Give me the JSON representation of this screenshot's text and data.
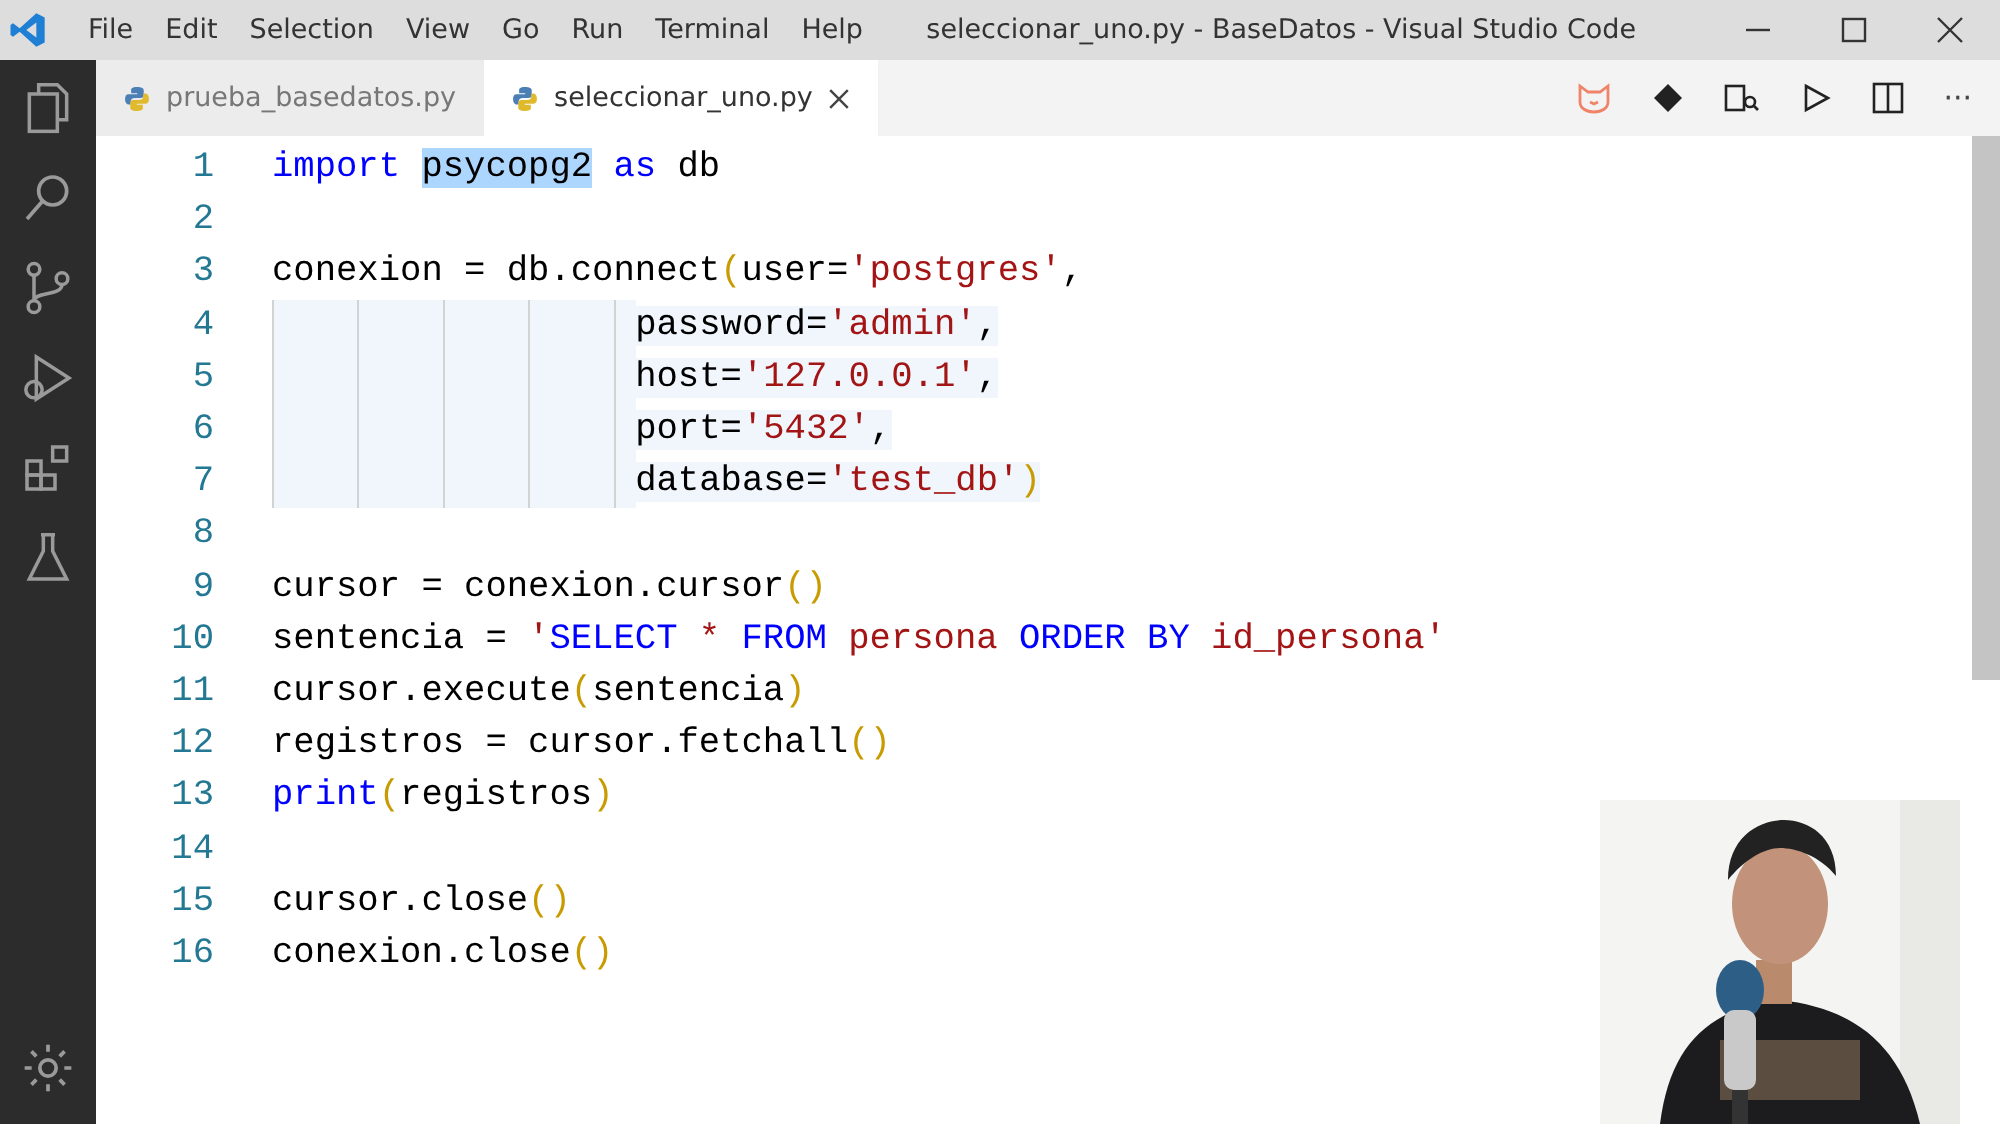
{
  "menu": [
    "File",
    "Edit",
    "Selection",
    "View",
    "Go",
    "Run",
    "Terminal",
    "Help"
  ],
  "window": {
    "title": "seleccionar_uno.py - BaseDatos - Visual Studio Code"
  },
  "tabs": [
    {
      "label": "prueba_basedatos.py",
      "selected": false
    },
    {
      "label": "seleccionar_uno.py",
      "selected": true
    }
  ],
  "editor_actions": {
    "more": "···"
  },
  "lines": [
    {
      "number": "1",
      "shaded": false,
      "continuation": false,
      "tokens": [
        {
          "kind": "kw",
          "text": "import "
        },
        {
          "kind": "sel",
          "text": "psycopg2"
        },
        {
          "kind": "kw",
          "text": " as"
        },
        {
          "kind": "plain",
          "text": " db"
        }
      ]
    },
    {
      "number": "2",
      "shaded": false,
      "continuation": false
    },
    {
      "number": "3",
      "shaded": false,
      "continuation": false,
      "tokens": [
        {
          "kind": "plain",
          "text": "conexion = db.connect"
        },
        {
          "kind": "bracket",
          "text": "("
        },
        {
          "kind": "plain",
          "text": "user="
        },
        {
          "kind": "str",
          "text": "'postgres'"
        },
        {
          "kind": "plain",
          "text": ","
        }
      ]
    },
    {
      "number": "4",
      "shaded": true,
      "continuation": true,
      "tokens": [
        {
          "kind": "plain",
          "text": "password="
        },
        {
          "kind": "str",
          "text": "'admin'"
        },
        {
          "kind": "plain",
          "text": ","
        }
      ]
    },
    {
      "number": "5",
      "shaded": true,
      "continuation": true,
      "tokens": [
        {
          "kind": "plain",
          "text": "host="
        },
        {
          "kind": "str",
          "text": "'127.0.0.1'"
        },
        {
          "kind": "plain",
          "text": ","
        }
      ]
    },
    {
      "number": "6",
      "shaded": true,
      "continuation": true,
      "tokens": [
        {
          "kind": "plain",
          "text": "port="
        },
        {
          "kind": "str",
          "text": "'5432'"
        },
        {
          "kind": "plain",
          "text": ","
        }
      ]
    },
    {
      "number": "7",
      "shaded": true,
      "continuation": true,
      "tokens": [
        {
          "kind": "plain",
          "text": "database="
        },
        {
          "kind": "str",
          "text": "'test_db'"
        },
        {
          "kind": "bracket",
          "text": ")"
        }
      ]
    },
    {
      "number": "8",
      "shaded": false,
      "continuation": false
    },
    {
      "number": "9",
      "shaded": false,
      "continuation": false,
      "tokens": [
        {
          "kind": "plain",
          "text": "cursor = conexion.cursor"
        },
        {
          "kind": "bracket",
          "text": "()"
        }
      ]
    },
    {
      "number": "10",
      "shaded": false,
      "continuation": false,
      "tokens": [
        {
          "kind": "plain",
          "text": "sentencia = "
        },
        {
          "kind": "str",
          "text": "'"
        },
        {
          "kind": "sqlkw",
          "text": "SELECT"
        },
        {
          "kind": "str",
          "text": " * "
        },
        {
          "kind": "sqlkw",
          "text": "FROM"
        },
        {
          "kind": "str",
          "text": " persona "
        },
        {
          "kind": "sqlkw",
          "text": "ORDER BY"
        },
        {
          "kind": "str",
          "text": " id_persona'"
        }
      ]
    },
    {
      "number": "11",
      "shaded": false,
      "continuation": false,
      "tokens": [
        {
          "kind": "plain",
          "text": "cursor.execute"
        },
        {
          "kind": "bracket",
          "text": "("
        },
        {
          "kind": "plain",
          "text": "sentencia"
        },
        {
          "kind": "bracket",
          "text": ")"
        }
      ]
    },
    {
      "number": "12",
      "shaded": false,
      "continuation": false,
      "tokens": [
        {
          "kind": "plain",
          "text": "registros = cursor.fetchall"
        },
        {
          "kind": "bracket",
          "text": "()"
        }
      ]
    },
    {
      "number": "13",
      "shaded": false,
      "continuation": false,
      "tokens": [
        {
          "kind": "kw",
          "text": "print"
        },
        {
          "kind": "bracket",
          "text": "("
        },
        {
          "kind": "plain",
          "text": "registros"
        },
        {
          "kind": "bracket",
          "text": ")"
        }
      ]
    },
    {
      "number": "14",
      "shaded": false,
      "continuation": false
    },
    {
      "number": "15",
      "shaded": false,
      "continuation": false,
      "tokens": [
        {
          "kind": "plain",
          "text": "cursor.close"
        },
        {
          "kind": "bracket",
          "text": "()"
        }
      ]
    },
    {
      "number": "16",
      "shaded": false,
      "continuation": false,
      "tokens": [
        {
          "kind": "plain",
          "text": "conexion.close"
        },
        {
          "kind": "bracket",
          "text": "()"
        }
      ]
    }
  ]
}
